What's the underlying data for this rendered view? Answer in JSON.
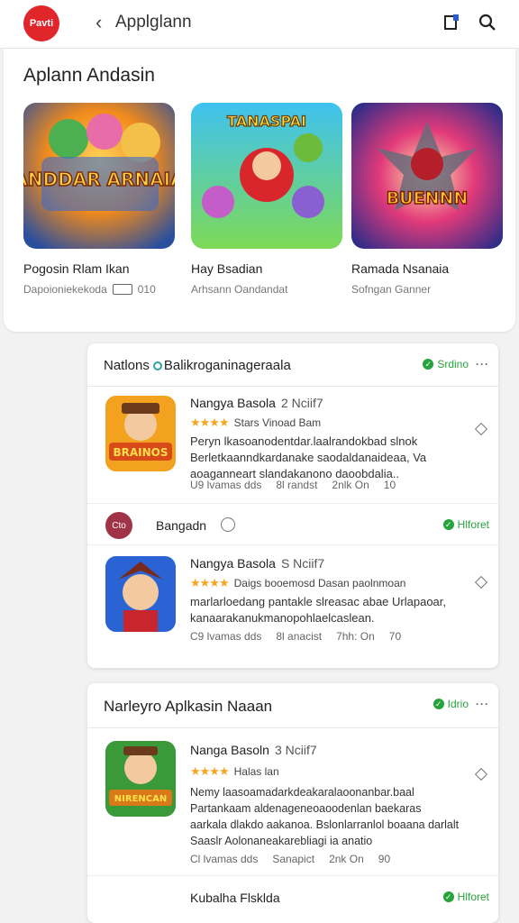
{
  "header": {
    "logo_text": "Pavti",
    "back_glyph": "‹",
    "title": "Applglann",
    "icons": [
      "share-icon",
      "search-icon"
    ]
  },
  "featured": {
    "heading": "Aplann Andasin",
    "apps": [
      {
        "name": "Pogosin Rlam Ikan",
        "meta": "Dapoioniekekoda",
        "meta2": "010",
        "art": "DANDDAR ARNAIAN"
      },
      {
        "name": "Hay Bsadian",
        "meta": "Arhsann Oandandat",
        "meta2": "",
        "art": "TANASPAI"
      },
      {
        "name": "Ramada Nsanaia",
        "meta": "Sofngan Ganner",
        "meta2": "",
        "art": "BUENNN"
      }
    ]
  },
  "card1": {
    "title_a": "Natlons",
    "title_b": "Balikroganinageraala",
    "status": "Srdino",
    "rows": [
      {
        "name": "Nangya Basola",
        "version": "2 Nciif7",
        "stars": "★★★★",
        "rating_text": "Stars Vinoad Bam",
        "desc": "Peryn lkasoanodentdar.laalrandokbad slnok Berletkaanndkardanake saodaldanaideaa, Va aoaganneart slandakanono daoobdalia..",
        "foot": [
          "U9 lvamas dds",
          "8l randst",
          "2nlk On",
          "10"
        ],
        "art": "BRAINOS"
      },
      {
        "name": "Nangya Basola",
        "version": "S Nciif7",
        "stars": "★★★★",
        "rating_text": "Daigs booemosd Dasan paolnmoan",
        "desc": "marlarloedang pantakle slreasac abae Urlapaoar, kanaarakanukmanopohlaelcaslean.",
        "foot": [
          "C9 lvamas dds",
          "8l anacist",
          "7hh: On",
          "70"
        ],
        "art": ""
      }
    ],
    "sub": {
      "badge": "Cto",
      "label": "Bangadn",
      "status": "Hlforet"
    }
  },
  "card2": {
    "title": "Narleyro Aplkasin Naaan",
    "status": "Idrio",
    "rows": [
      {
        "name": "Nanga Basoln",
        "version": "3 Nciif7",
        "stars": "★★★★",
        "rating_text": "Halas lan",
        "desc": "Nemy laasoamadarkdeakaralaoonanbar.baal Partankaam aldenageneoaoodenlan baekaras aarkala dlakdo aakanoa. Bslonlarranlol boaana darlalt Saaslr Aolonaneakarebliagi ia anatio",
        "foot": [
          "Cl lvamas dds",
          "Sanapict",
          "2nk On",
          "90"
        ],
        "art": "NIRENCAN"
      }
    ],
    "sub": {
      "label": "Kubalha Flsklda",
      "status": "Hlforet"
    }
  },
  "colors": {
    "accent_green": "#27a33b",
    "logo_red": "#e0252b",
    "star": "#f5a623"
  }
}
